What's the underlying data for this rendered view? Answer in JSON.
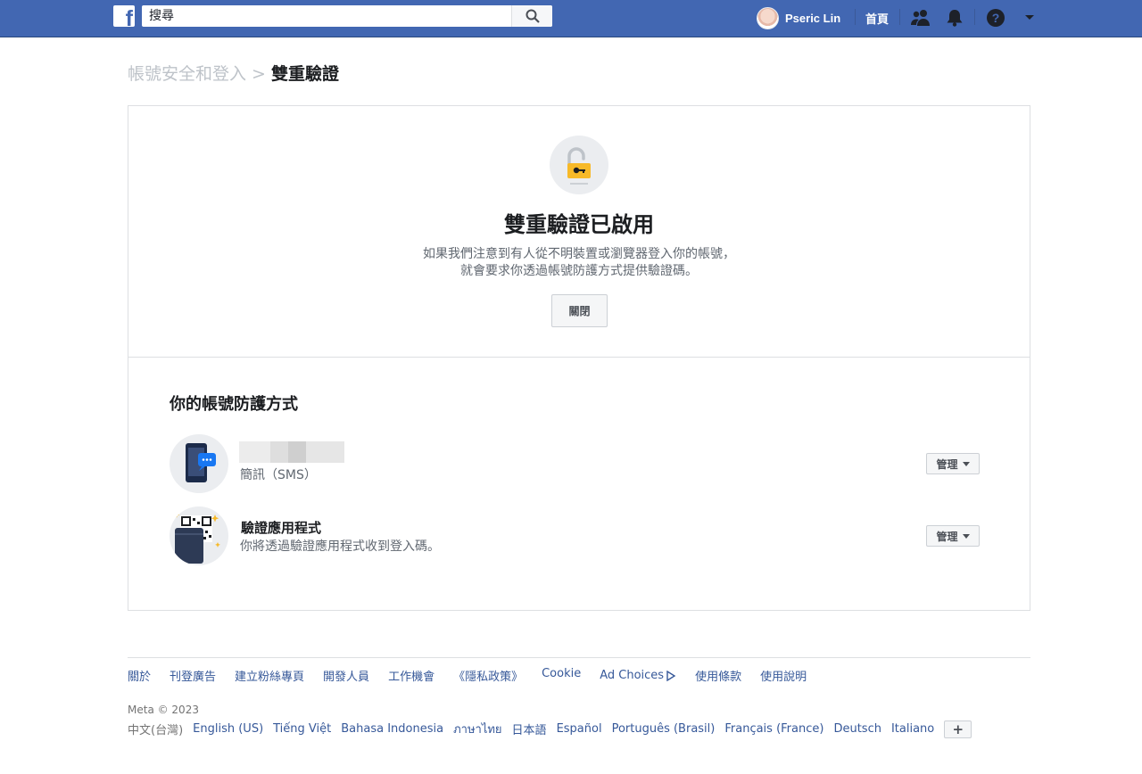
{
  "header": {
    "logo": "f",
    "search_placeholder": "搜尋",
    "profile_name": "Pseric Lin",
    "home_label": "首頁",
    "icons": [
      "friends-icon",
      "notifications-icon",
      "help-icon",
      "account-menu-icon"
    ]
  },
  "breadcrumb": {
    "parent": "帳號安全和登入",
    "separator": ">",
    "current": "雙重驗證"
  },
  "status": {
    "title": "雙重驗證已啟用",
    "description": "如果我們注意到有人從不明裝置或瀏覽器登入你的帳號，就會要求你透過帳號防護方式提供驗證碼。",
    "close_button": "關閉"
  },
  "protection": {
    "title": "你的帳號防護方式",
    "methods": [
      {
        "name": "",
        "subtitle": "簡訊（SMS）",
        "manage_label": "管理"
      },
      {
        "name": "驗證應用程式",
        "subtitle": "你將透過驗證應用程式收到登入碼。",
        "manage_label": "管理"
      }
    ]
  },
  "footer": {
    "links": [
      "關於",
      "刊登廣告",
      "建立粉絲專頁",
      "開發人員",
      "工作機會",
      "《隱私政策》",
      "Cookie",
      "Ad Choices",
      "使用條款",
      "使用說明"
    ],
    "copyright": "Meta © 2023",
    "current_language": "中文(台灣)",
    "languages": [
      "English (US)",
      "Tiếng Việt",
      "Bahasa Indonesia",
      "ภาษาไทย",
      "日本語",
      "Español",
      "Português (Brasil)",
      "Français (France)",
      "Deutsch",
      "Italiano"
    ],
    "more_languages": "+"
  },
  "colors": {
    "brand_blue": "#4267b2",
    "link_blue": "#365899",
    "lock_yellow": "#f7b928"
  }
}
